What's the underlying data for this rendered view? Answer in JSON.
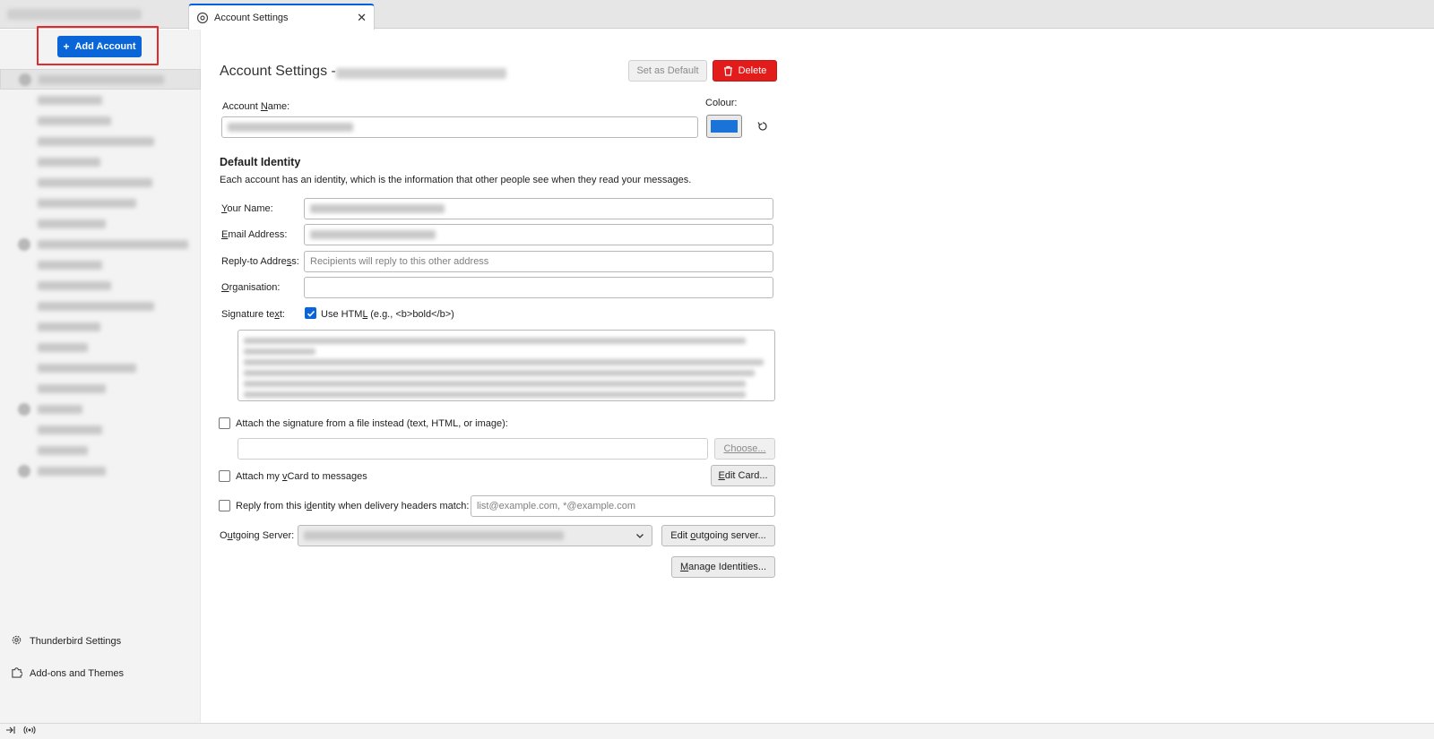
{
  "tabs": {
    "active_label": "Account Settings",
    "close_glyph": "✕"
  },
  "sidebar": {
    "add_account_label": "Add Account",
    "bottom_items": [
      {
        "label": "Thunderbird Settings",
        "icon": "gear-icon"
      },
      {
        "label": "Add-ons and Themes",
        "icon": "puzzle-icon"
      }
    ]
  },
  "header": {
    "title": "Account Settings -",
    "set_default_label": "Set as Default",
    "delete_label": "Delete"
  },
  "account": {
    "name_label_prefix": "Account ",
    "name_label_mnemonic": "N",
    "name_label_suffix": "ame:",
    "colour_label": "Colour:",
    "colour_value": "#1a73d9"
  },
  "identity": {
    "section_title": "Default Identity",
    "description": "Each account has an identity, which is the information that other people see when they read your messages.",
    "your_name_mnemonic": "Y",
    "your_name_rest": "our Name:",
    "email_mnemonic": "E",
    "email_rest": "mail Address:",
    "reply_to_prefix": "Reply-to Addre",
    "reply_to_mnemonic": "s",
    "reply_to_suffix": "s:",
    "reply_to_placeholder": "Recipients will reply to this other address",
    "organisation_mnemonic": "O",
    "organisation_rest": "rganisation:",
    "signature_prefix": "Signature te",
    "signature_mnemonic": "x",
    "signature_suffix": "t:",
    "use_html_prefix": "Use HTM",
    "use_html_mnemonic": "L",
    "use_html_suffix": " (e.g., <b>bold</b>)",
    "attach_sig_label": "Attach the signature from a file instead (text, HTML, or image):",
    "choose_label": "Choose...",
    "attach_vcard_prefix": "Attach my ",
    "attach_vcard_mnemonic": "v",
    "attach_vcard_suffix": "Card to messages",
    "edit_card_prefix": "",
    "edit_card_mnemonic": "E",
    "edit_card_suffix": "dit Card...",
    "reply_from_prefix": "Reply from this i",
    "reply_from_mnemonic": "d",
    "reply_from_suffix": "entity when delivery headers match:",
    "reply_from_placeholder": "list@example.com, *@example.com",
    "outgoing_prefix": "O",
    "outgoing_mnemonic": "u",
    "outgoing_suffix": "tgoing Server:",
    "edit_outgoing_prefix": "Edit ",
    "edit_outgoing_mnemonic": "o",
    "edit_outgoing_suffix": "utgoing server...",
    "manage_prefix": "",
    "manage_mnemonic": "M",
    "manage_suffix": "anage Identities..."
  },
  "colors": {
    "accent": "#0a66d8",
    "danger": "#e21b1b",
    "highlight": "#e22a2a"
  }
}
